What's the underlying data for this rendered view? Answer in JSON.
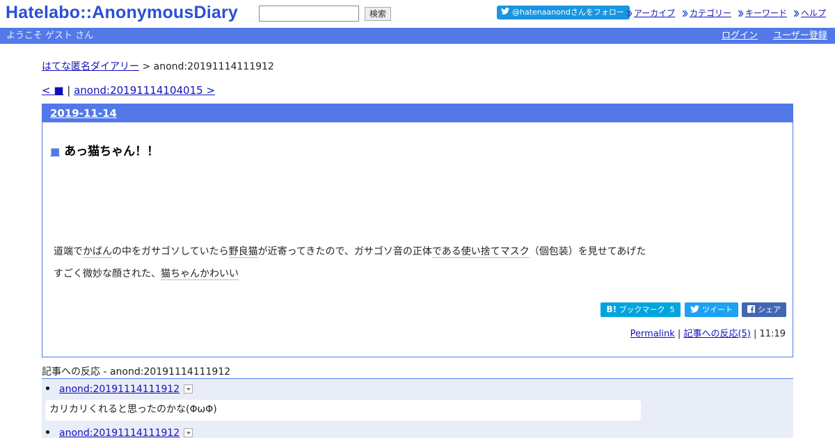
{
  "header": {
    "logo_left": "Hatelabo",
    "logo_sep": "::",
    "logo_right": "AnonymousDiary",
    "search_placeholder": "",
    "search_button": "検索",
    "follow_label": "@hatenaanondさんをフォロー",
    "nav": [
      "アーカイブ",
      "カテゴリー",
      "キーワード",
      "ヘルプ"
    ]
  },
  "welcome": {
    "greeting": "ようこそ ゲスト さん",
    "login": "ログイン",
    "register": "ユーザー登録"
  },
  "breadcrumb": {
    "home": "はてな匿名ダイアリー",
    "sep": " > ",
    "current": "anond:20191114111912"
  },
  "pager": {
    "prev": "< ■",
    "sep": " | ",
    "next": "anond:20191114104015 >"
  },
  "entry": {
    "date": "2019-11-14",
    "mark": "■",
    "title": "あっ猫ちゃん！！",
    "line1": {
      "p1": "道端で",
      "k1": "かばん",
      "p2": "の中をガサゴソしていたら",
      "k2": "野良猫",
      "p3": "が近寄ってきたので、ガサゴソ音の正体",
      "k3": "である使い捨てマスク",
      "p4": "（個包装）を見せてあげた"
    },
    "line2": {
      "p1": "すごく微妙な顔された、",
      "k1": "猫ちゃんかわいい"
    },
    "share": {
      "hatena_logo": "B!",
      "hatena_label": "ブックマーク",
      "hatena_count": "5",
      "tweet": "ツイート",
      "facebook": "シェア"
    },
    "footer": {
      "permalink": "Permalink",
      "reactions_link": "記事への反応(5)",
      "sep": " | ",
      "time": "11:19"
    }
  },
  "reactions": {
    "title": "記事への反応 - anond:20191114111912",
    "items": [
      {
        "id": "anond:20191114111912",
        "text": "カリカリくれると思ったのかな(ΦωΦ)"
      },
      {
        "id": "anond:20191114111912",
        "text": ""
      }
    ]
  }
}
